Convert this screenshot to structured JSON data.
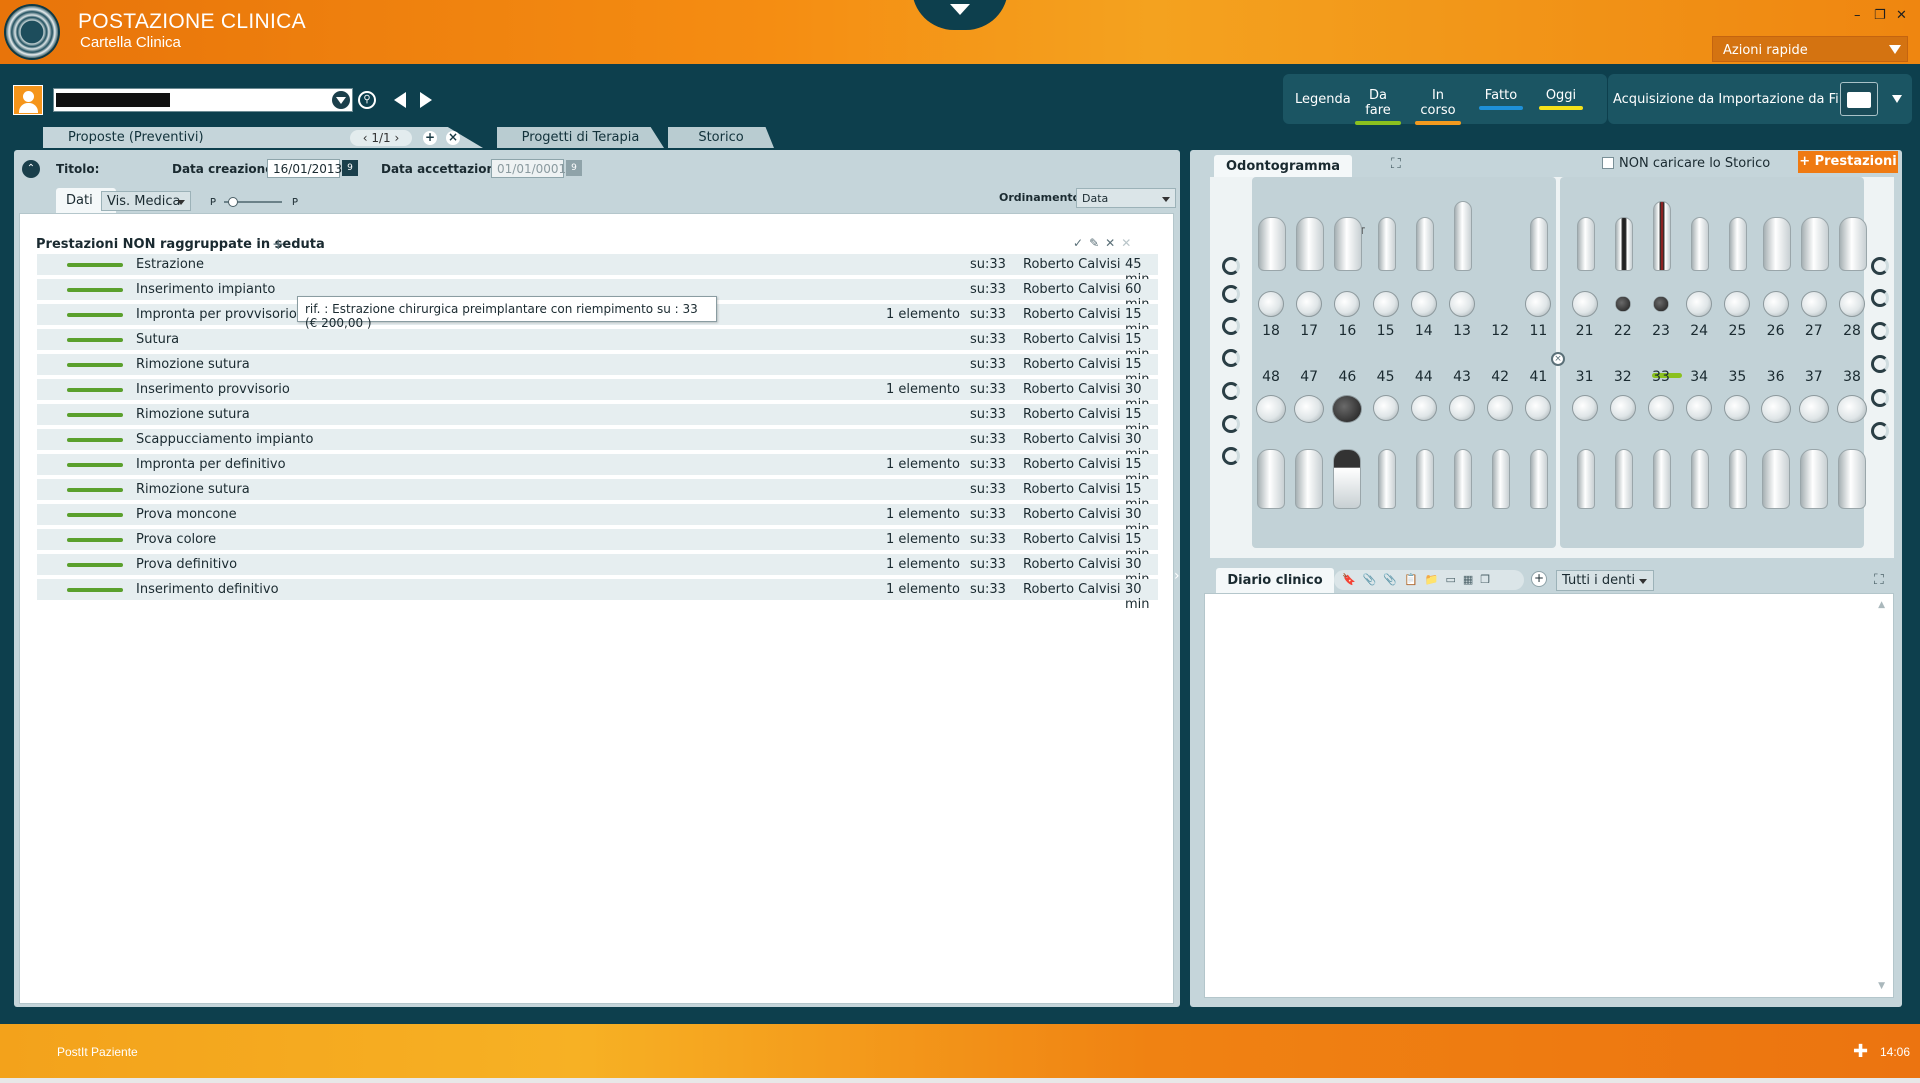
{
  "header": {
    "title": "POSTAZIONE CLINICA",
    "subtitle": "Cartella Clinica",
    "quick_actions": "Azioni rapide",
    "win_min": "–",
    "win_restore": "❐",
    "win_close": "✕"
  },
  "legend": {
    "label": "Legenda",
    "items": [
      {
        "label": "Da fare",
        "color": "#8bc11f"
      },
      {
        "label": "In corso",
        "color": "#f29a1f"
      },
      {
        "label": "Fatto",
        "color": "#1e90d8"
      },
      {
        "label": "Oggi",
        "color": "#f5e11a"
      }
    ]
  },
  "import": {
    "label": "Acquisizione da Importazione da File"
  },
  "tabs": {
    "proposte": "Proposte (Preventivi)",
    "pager": "1/1",
    "progetti": "Progetti di Terapia",
    "storico": "Storico"
  },
  "form": {
    "titolo_label": "Titolo:",
    "data_creazione_label": "Data creazione",
    "data_creazione": "16/01/2013",
    "data_accettazione_label": "Data accettazione",
    "data_accettazione": "01/01/0001",
    "dati_tab": "Dati",
    "vis_medica": "Vis. Medica",
    "ordinamento_label": "Ordinamento",
    "ordinamento_value": "Data"
  },
  "section": {
    "title": "Prestazioni NON raggruppate in seduta",
    "add": "+"
  },
  "rows": [
    {
      "name": "Estrazione",
      "elem": "",
      "tooth": "su:33",
      "doctor": "Roberto Calvisi",
      "dur": "45 min"
    },
    {
      "name": "Inserimento impianto",
      "elem": "",
      "tooth": "su:33",
      "doctor": "Roberto Calvisi",
      "dur": "60 min"
    },
    {
      "name": "Impronta per provvisorio",
      "elem": "1 elemento",
      "tooth": "su:33",
      "doctor": "Roberto Calvisi",
      "dur": "15 min"
    },
    {
      "name": "Sutura",
      "elem": "",
      "tooth": "su:33",
      "doctor": "Roberto Calvisi",
      "dur": "15 min"
    },
    {
      "name": "Rimozione sutura",
      "elem": "",
      "tooth": "su:33",
      "doctor": "Roberto Calvisi",
      "dur": "15 min"
    },
    {
      "name": "Inserimento provvisorio",
      "elem": "1 elemento",
      "tooth": "su:33",
      "doctor": "Roberto Calvisi",
      "dur": "30 min"
    },
    {
      "name": "Rimozione sutura",
      "elem": "",
      "tooth": "su:33",
      "doctor": "Roberto Calvisi",
      "dur": "15 min"
    },
    {
      "name": "Scappucciamento impianto",
      "elem": "",
      "tooth": "su:33",
      "doctor": "Roberto Calvisi",
      "dur": "30 min"
    },
    {
      "name": "Impronta per definitivo",
      "elem": "1 elemento",
      "tooth": "su:33",
      "doctor": "Roberto Calvisi",
      "dur": "15 min"
    },
    {
      "name": "Rimozione sutura",
      "elem": "",
      "tooth": "su:33",
      "doctor": "Roberto Calvisi",
      "dur": "15 min"
    },
    {
      "name": "Prova moncone",
      "elem": "1 elemento",
      "tooth": "su:33",
      "doctor": "Roberto Calvisi",
      "dur": "30 min"
    },
    {
      "name": "Prova colore",
      "elem": "1 elemento",
      "tooth": "su:33",
      "doctor": "Roberto Calvisi",
      "dur": "15 min"
    },
    {
      "name": "Prova definitivo",
      "elem": "1 elemento",
      "tooth": "su:33",
      "doctor": "Roberto Calvisi",
      "dur": "30 min"
    },
    {
      "name": "Inserimento definitivo",
      "elem": "1 elemento",
      "tooth": "su:33",
      "doctor": "Roberto Calvisi",
      "dur": "30 min"
    }
  ],
  "tooltip": "rif. :   Estrazione chirurgica preimplantare con riempimento su : 33 (€ 200,00 )",
  "odontogramma": {
    "tab": "Odontogramma",
    "non_storico": "NON caricare lo Storico",
    "btn_prestazioni": "+ Prestazioni",
    "ott": "OTT",
    "upper": [
      "18",
      "17",
      "16",
      "15",
      "14",
      "13",
      "12",
      "11",
      "21",
      "22",
      "23",
      "24",
      "25",
      "26",
      "27",
      "28"
    ],
    "lower": [
      "48",
      "47",
      "46",
      "45",
      "44",
      "43",
      "42",
      "41",
      "31",
      "32",
      "33",
      "34",
      "35",
      "36",
      "37",
      "38"
    ]
  },
  "diario": {
    "tab": "Diario clinico",
    "tools": "🔖📎📎📋📁▭▦❒",
    "filter": "Tutti i denti"
  },
  "footer": {
    "postit": "PostIt Paziente",
    "time": "14:06"
  }
}
